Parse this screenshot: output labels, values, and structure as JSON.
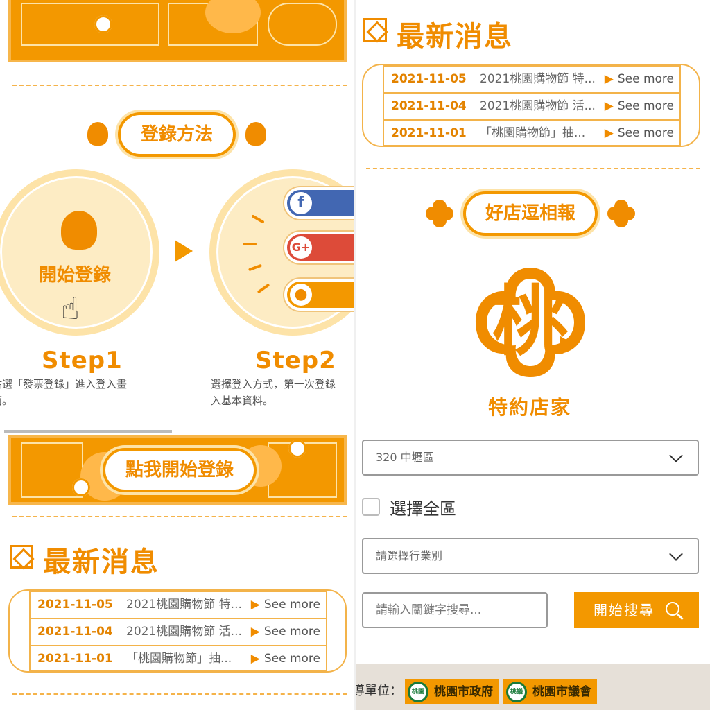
{
  "left": {
    "login_method_title": "登錄方法",
    "step1": {
      "circle_label": "開始登錄",
      "title": "Step1",
      "desc_line1": "點選「發票登錄」進入登入畫",
      "desc_line2": "面。"
    },
    "step2": {
      "title": "Step2",
      "desc_line1": "選擇登入方式，第一次登錄",
      "desc_line2": "入基本資料。"
    },
    "cta_banner_label": "點我開始登錄",
    "news": {
      "heading": "最新消息",
      "items": [
        {
          "date": "2021-11-05",
          "title": "2021桃園購物節 特...",
          "more": "See more"
        },
        {
          "date": "2021-11-04",
          "title": "2021桃園購物節 活...",
          "more": "See more"
        },
        {
          "date": "2021-11-01",
          "title": "「桃園購物節」抽...",
          "more": "See more"
        }
      ]
    }
  },
  "right": {
    "news": {
      "heading": "最新消息",
      "items": [
        {
          "date": "2021-11-05",
          "title": "2021桃園購物節 特...",
          "more": "See more"
        },
        {
          "date": "2021-11-04",
          "title": "2021桃園購物節 活...",
          "more": "See more"
        },
        {
          "date": "2021-11-01",
          "title": "「桃園購物節」抽...",
          "more": "See more"
        }
      ]
    },
    "store_section_title": "好店逗相報",
    "logo_char": "桃",
    "store_label": "特約店家",
    "district_select": "320 中壢區",
    "select_all_label": "選擇全區",
    "industry_select": "請選擇行業別",
    "keyword_placeholder": "請輸入關鍵字搜尋...",
    "search_button": "開始搜尋",
    "footer": {
      "organizer_label": "導單位：",
      "gov1": "桃園市政府",
      "gov1_seal": "桃園",
      "gov2": "桃園市議會",
      "gov2_seal": "桃議"
    }
  },
  "colors": {
    "accent": "#f39800",
    "accent_text": "#f08c00",
    "light": "#fde3a8"
  }
}
